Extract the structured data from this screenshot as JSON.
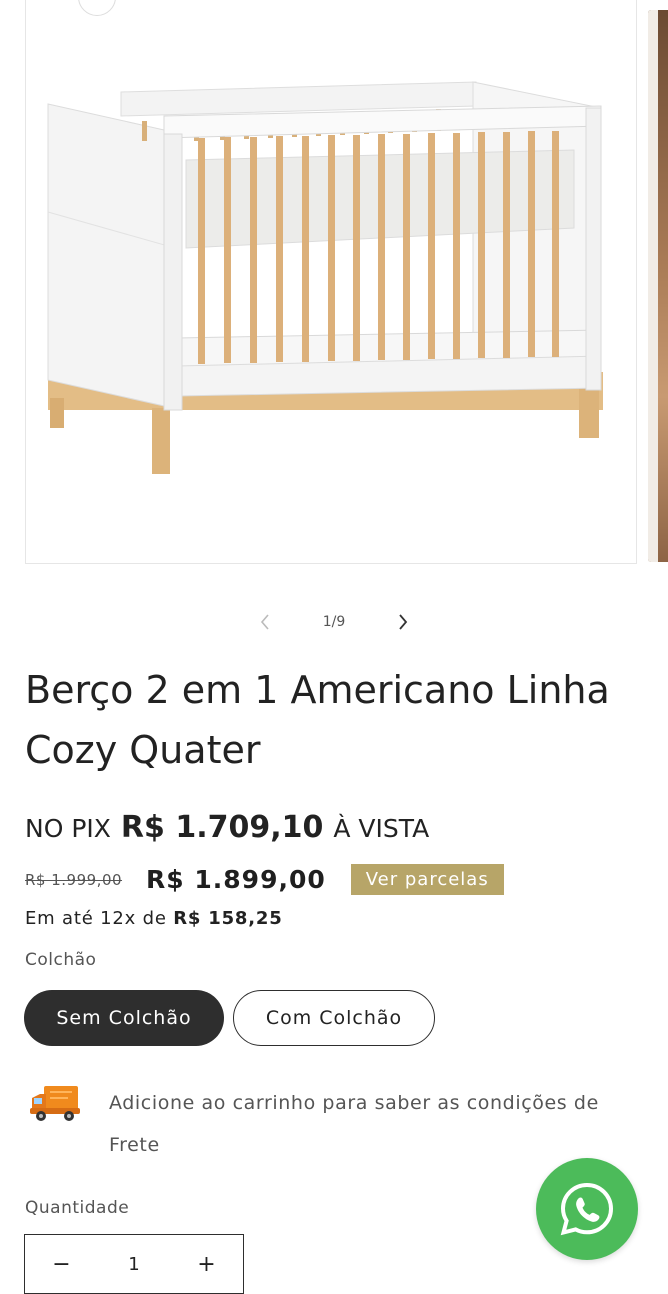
{
  "gallery": {
    "counter": "1/9",
    "image_alt": "Berço 2 em 1 Americano Linha Cozy Quater"
  },
  "product": {
    "title": "Berço 2 em 1 Americano Linha Cozy Quater",
    "pix": {
      "prefix": "NO PIX",
      "price": "R$ 1.709,10",
      "suffix": "À VISTA"
    },
    "old_price": "R$ 1.999,00",
    "price": "R$ 1.899,00",
    "installments_button": "Ver parcelas",
    "installments_text_prefix": "Em até 12x de",
    "installments_value": "R$ 158,25",
    "option_label": "Colchão",
    "options": [
      "Sem Colchão",
      "Com Colchão"
    ],
    "selected_option": "Sem Colchão",
    "freight_text": "Adicione ao carrinho para saber as condições de Frete",
    "quantity_label": "Quantidade",
    "quantity_value": "1"
  },
  "icons": {
    "prev": "chevron-left-icon",
    "next": "chevron-right-icon",
    "freight": "truck-icon",
    "whatsapp": "whatsapp-icon",
    "minus": "minus-icon",
    "plus": "plus-icon"
  },
  "colors": {
    "installments_button": "#b7a568",
    "selected_pill": "#2e2e2e",
    "whatsapp": "#4cbb5a",
    "truck": "#f08a1d"
  }
}
